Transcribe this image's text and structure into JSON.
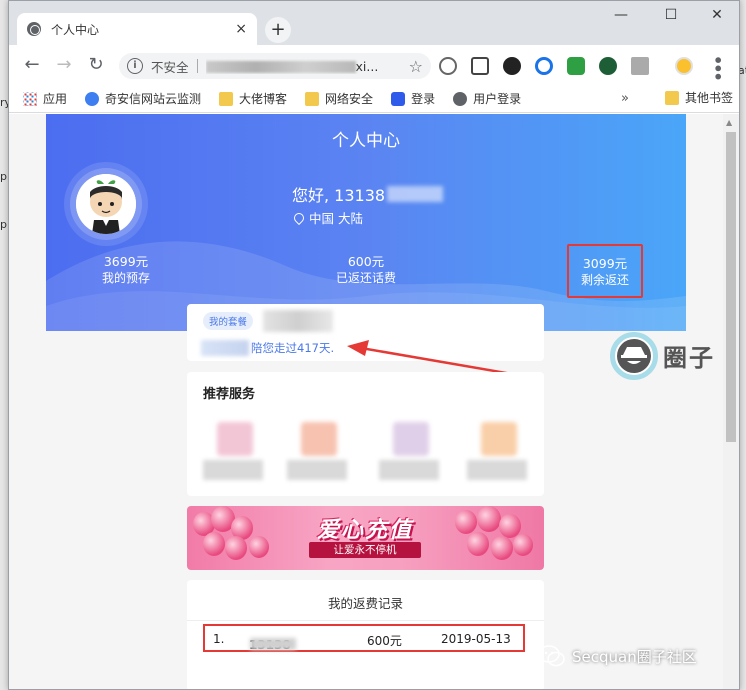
{
  "background_window": {
    "left_fragments": [
      "ry",
      "p",
      "p"
    ],
    "right_fragments": [
      "at"
    ]
  },
  "browser": {
    "tab_title": "个人中心",
    "tab_close": "×",
    "new_tab": "+",
    "window_controls": {
      "minimize": "—",
      "maximize": "☐",
      "close": "✕"
    },
    "nav": {
      "back": "←",
      "forward": "→",
      "reload": "↻"
    },
    "address": {
      "security_label": "不安全",
      "url_suffix": "xi..."
    },
    "bookmarks": [
      {
        "label": "应用",
        "icon": "apps-grid-icon"
      },
      {
        "label": "奇安信网站云监测",
        "icon": "qianxin-icon"
      },
      {
        "label": "大佬博客",
        "icon": "folder-icon"
      },
      {
        "label": "网络安全",
        "icon": "folder-icon"
      },
      {
        "label": "登录",
        "icon": "baidu-icon"
      },
      {
        "label": "用户登录",
        "icon": "globe-icon"
      }
    ],
    "bookmarks_more": "»",
    "other_bookmarks": "其他书签"
  },
  "page": {
    "header_title": "个人中心",
    "greeting_prefix": "您好, 13138",
    "location": "中国  大陆",
    "stats": [
      {
        "value": "3699元",
        "label": "我的预存"
      },
      {
        "value": "600元",
        "label": "已返还话费"
      },
      {
        "value": "3099元",
        "label": "剩余返还"
      }
    ],
    "package_badge": "我的套餐",
    "company_text": "陪您走过417天.",
    "services_title": "推荐服务",
    "banner_title": "爱心充值",
    "banner_subtitle": "让爱永不停机",
    "records_title": "我的返费记录",
    "records": [
      {
        "index": "1.",
        "phone": "13138",
        "amount": "600元",
        "date": "2019-05-13"
      }
    ],
    "side_logo_text": "圈子"
  },
  "watermark": "Secquan圈子社区",
  "colors": {
    "header_gradient_start": "#4c6df0",
    "header_gradient_end": "#4aa6f8",
    "accent_blue": "#4a78e8",
    "highlight_red": "#e53935",
    "banner_pink": "#f17ba7"
  }
}
